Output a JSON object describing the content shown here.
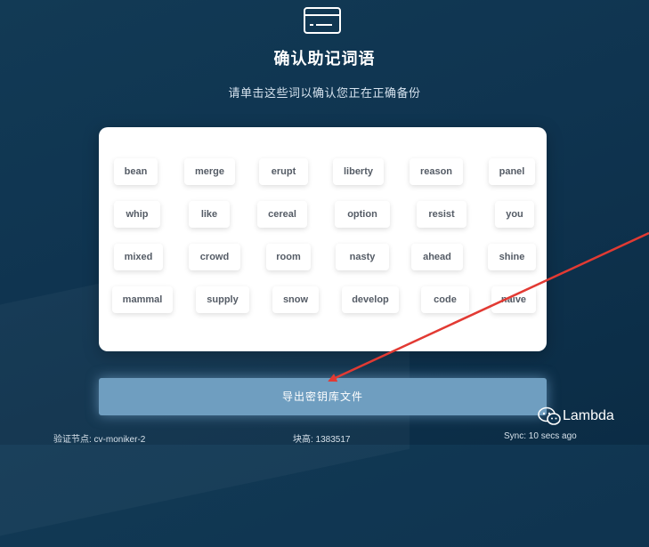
{
  "header": {
    "icon": "wallet-card-icon",
    "title": "确认助记词语",
    "subtitle": "请单击这些词以确认您正在正确备份"
  },
  "words": [
    [
      "bean",
      "merge",
      "erupt",
      "liberty",
      "reason",
      "panel"
    ],
    [
      "whip",
      "like",
      "cereal",
      "option",
      "resist",
      "you"
    ],
    [
      "mixed",
      "crowd",
      "room",
      "nasty",
      "ahead",
      "shine"
    ],
    [
      "mammal",
      "supply",
      "snow",
      "develop",
      "code",
      "naive"
    ]
  ],
  "export_button": "导出密钥库文件",
  "footer": {
    "node": "验证节点: cv-moniker-2",
    "block_height": "块高: 1383517",
    "sync": "Sync: 10 secs ago"
  },
  "watermark": {
    "icon": "wechat-icon",
    "text": "Lambda"
  },
  "colors": {
    "background": "#0f3450",
    "button": "#6f9ec0",
    "arrow": "#e23a33"
  }
}
